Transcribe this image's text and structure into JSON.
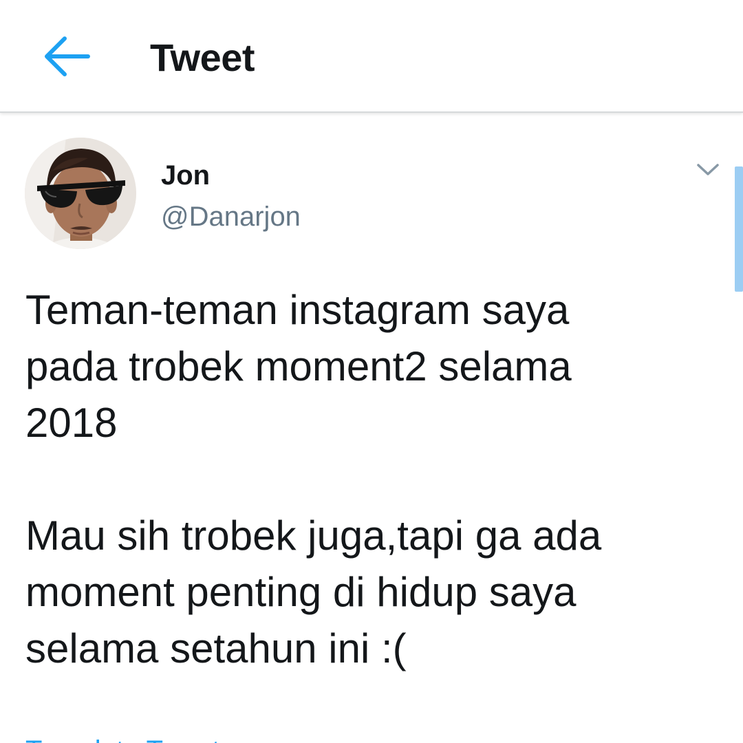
{
  "header": {
    "back_icon": "arrow-left-icon",
    "title": "Tweet"
  },
  "tweet": {
    "author": {
      "display_name": "Jon",
      "handle": "@Danarjon",
      "avatar_icon": "avatar-photo"
    },
    "menu_icon": "chevron-down-icon",
    "paragraphs": [
      "Teman-teman instagram saya\npada trobek moment2 selama\n2018",
      "Mau sih trobek juga,tapi ga ada\nmoment penting di hidup saya\nselama setahun ini :("
    ],
    "translate_label": "Translate Tweet"
  },
  "colors": {
    "accent": "#1da1f2",
    "text_primary": "#14171a",
    "text_secondary": "#657786",
    "divider": "#d6d9db",
    "scrollbar": "#9ccdf3"
  }
}
